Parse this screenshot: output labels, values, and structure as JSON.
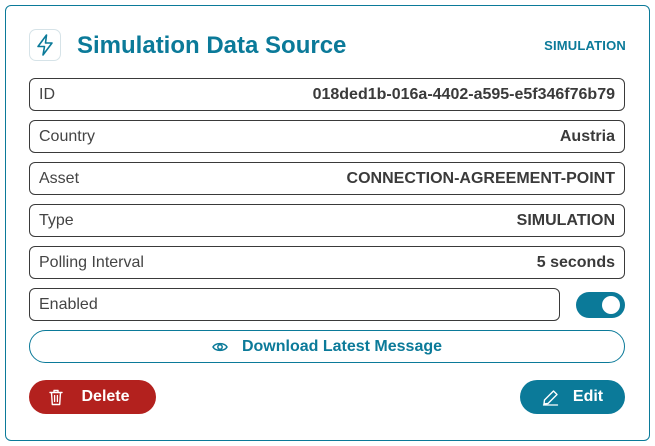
{
  "header": {
    "title": "Simulation Data Source",
    "badge": "SIMULATION",
    "icon": "lightning-bolt-icon"
  },
  "fields": [
    {
      "label": "ID",
      "value": "018ded1b-016a-4402-a595-e5f346f76b79"
    },
    {
      "label": "Country",
      "value": "Austria"
    },
    {
      "label": "Asset",
      "value": "CONNECTION-AGREEMENT-POINT"
    },
    {
      "label": "Type",
      "value": "SIMULATION"
    },
    {
      "label": "Polling Interval",
      "value": "5 seconds"
    }
  ],
  "enabled": {
    "label": "Enabled",
    "on": true
  },
  "actions": {
    "download_label": "Download Latest Message",
    "delete_label": "Delete",
    "edit_label": "Edit"
  },
  "colors": {
    "accent": "#0b7a99",
    "danger": "#b3211e"
  }
}
